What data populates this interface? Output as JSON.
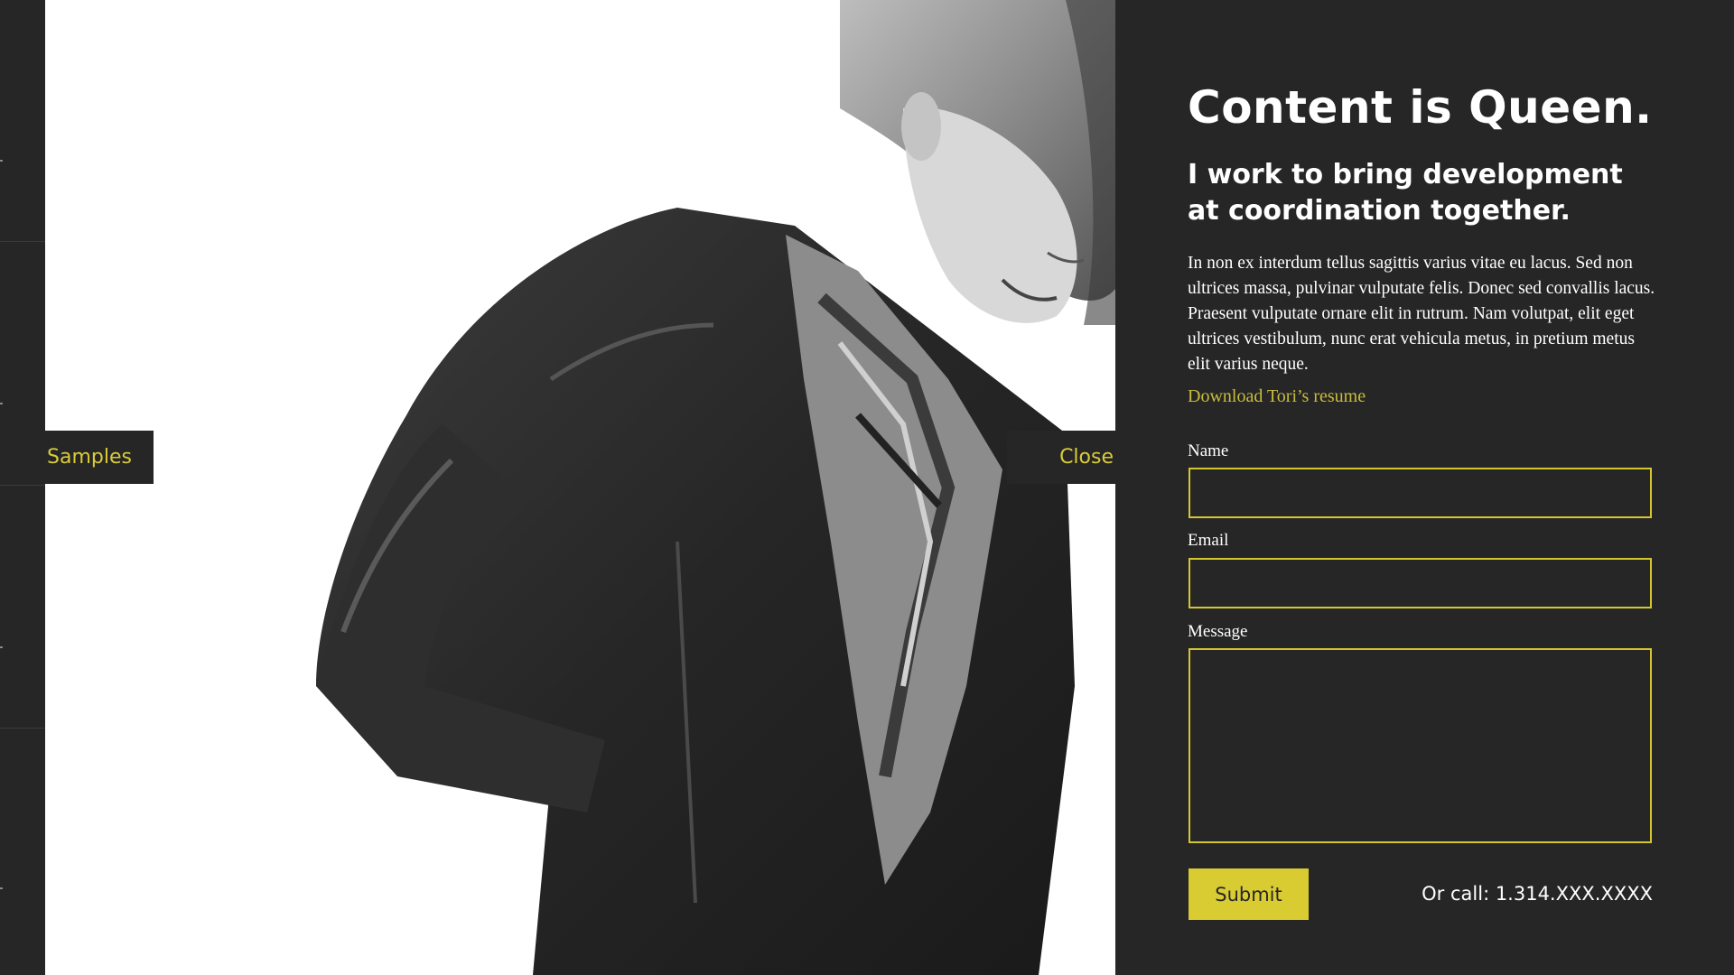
{
  "nav": {
    "samples_label": "Samples",
    "close_label": "Close"
  },
  "panel": {
    "title": "Content is Queen.",
    "subtitle": "I work to bring development at coordination together.",
    "body": "In non ex interdum tellus sagittis varius vitae eu lacus. Sed non ultrices massa, pulvinar vulputate felis. Donec sed convallis lacus. Praesent vulputate ornare elit in rutrum. Nam volutpat, elit eget ultrices vestibulum, nunc erat vehicula metus, in pretium metus elit varius neque.",
    "resume_link": "Download Tori’s resume"
  },
  "form": {
    "name_label": "Name",
    "name_value": "",
    "email_label": "Email",
    "email_value": "",
    "message_label": "Message",
    "message_value": "",
    "submit_label": "Submit",
    "call_text": "Or call: 1.314.XXX.XXXX"
  },
  "colors": {
    "accent": "#d9cc33",
    "background": "#262626",
    "text": "#ffffff"
  }
}
